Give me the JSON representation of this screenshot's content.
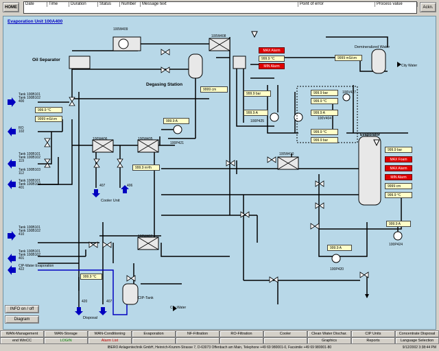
{
  "topbar": {
    "home_label": "HOME",
    "ack_label": "Ackn.",
    "columns": [
      "Date",
      "Time",
      "Duration",
      "Status",
      "Number",
      "Message text",
      "Point of error",
      "Process value"
    ]
  },
  "title": "Evaporation Unit 100A400",
  "labels": {
    "oil_separator": "Oil Separator",
    "degasing_station": "Degasing Station",
    "demineralized_water": "Demineralized Water",
    "city_water_1": "City Water",
    "city_water_2": "City Water",
    "evaporator": "Evaporator",
    "cooler_unit": "Cooler Unit",
    "cip_tank": "CIP-Tank",
    "disposal": "Disposal",
    "v409": "100W409",
    "v408": "100W408",
    "v406": "100W406",
    "v405": "100W405",
    "v407": "100W407",
    "v410": "100W410",
    "p421": "100P421",
    "p425": "100P425",
    "p404": "100V404",
    "p427": "100V427",
    "p424": "100P424",
    "p420": "100P420",
    "n407": "407",
    "n406": "406",
    "n420": "420",
    "n407b": "407"
  },
  "left_streams": [
    {
      "name": "Tank 100B101",
      "name2": "Tank 100B102",
      "num": "400"
    },
    {
      "name": "RO",
      "name2": "",
      "num": "102"
    },
    {
      "name": "Tank 100B101",
      "name2": "Tank 100B102",
      "num": "119"
    },
    {
      "name": "Tank 100B103",
      "name2": "",
      "num": "112"
    },
    {
      "name": "Tank 100B101",
      "name2": "Tank 100B102",
      "num": "401"
    },
    {
      "name": "Tank 100B101",
      "name2": "Tank 100B102",
      "num": "410"
    },
    {
      "name": "Tank 100B101",
      "name2": "Tank 100B102",
      "num": "401"
    },
    {
      "name": "CIP-Water Evaporation",
      "name2": "",
      "num": "422"
    }
  ],
  "values": {
    "temp_left": "999.9 °C",
    "cond_left": "9999 mS/cm",
    "amp_p421": "999.9 A",
    "flow_405": "999.9 m³/h",
    "level_degas": "9999 cm",
    "cond_demin": "9999 mS/cm",
    "temp_top": "999.9 °C",
    "bar_1": "999.9 bar",
    "amp_p425": "999.9 A",
    "bar_427": "999.9 bar",
    "temp_427": "999.9 °C",
    "amp_404": "999.9 A",
    "temp_404": "999.9 °C",
    "bar_404": "999.9 bar",
    "bar_evap": "999.9 bar",
    "level_evap": "9999 cm",
    "temp_evap": "999.9 °C",
    "amp_424": "999.9 A",
    "amp_420": "999.9 A",
    "temp_cip": "999.9 °C"
  },
  "alarms": {
    "max_top": "MAX Alarm",
    "min_top": "MIN Alarm",
    "foam_evap": "MAX Foam",
    "max_evap": "MAX Alarm",
    "min_evap": "MIN Alarm"
  },
  "side_buttons": {
    "info": "INFO on / off",
    "diagram": "Diagram"
  },
  "nav_row1": [
    "WAN-Management",
    "WAN-Storage",
    "WAN-Conditioning",
    "Evaporation",
    "NF-Filtration",
    "RO-Filtration",
    "Cooler",
    "Clean Water Dischar.",
    "CIP Units",
    "Concentrate Disposal"
  ],
  "nav_row2": [
    "end WinCC",
    "LOGIN",
    "Alarm List",
    "",
    "",
    "",
    "",
    "Graphics",
    "Reports",
    "Language Selection"
  ],
  "footer": "IBERO Anlagentechnik GmbH, Heinrich-Krumm-Strasse 7, D-63073 Offenbach am Main, Telephone +49 69 980001-0, Facsimile +49 69 980001-80",
  "datetime": "9/12/2002 3:38:44 PM",
  "colors": {
    "canvas": "#b8d8e8",
    "pipe": "#000000",
    "cip_pipe": "#0000c0",
    "alarm": "#e00000",
    "value_bg": "#ffffc8",
    "login": "#008000",
    "alarmlist": "#c00000"
  }
}
